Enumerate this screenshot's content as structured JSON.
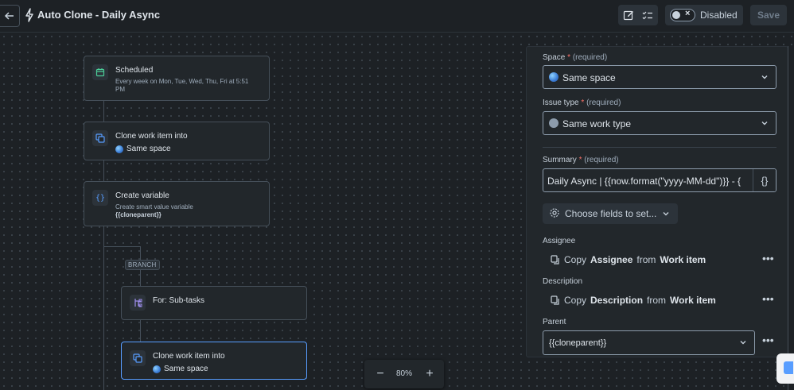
{
  "header": {
    "back_icon": "arrow-left-icon",
    "rule_icon": "lightning-bolt-icon",
    "title": "Auto Clone - Daily Async",
    "toggle_label": "Disabled",
    "save_label": "Save"
  },
  "canvas": {
    "nodes": {
      "scheduled": {
        "title": "Scheduled",
        "sub": "Every week on Mon, Tue, Wed, Thu, Fri at 5:51 PM"
      },
      "clone1": {
        "title": "Clone work item into",
        "sub": "Same space"
      },
      "variable": {
        "title": "Create variable",
        "sub": "Create smart value variable",
        "var": "{{cloneparent}}"
      },
      "branch_tag": "BRANCH",
      "for_subtasks": {
        "title": "For: Sub-tasks"
      },
      "clone2": {
        "title": "Clone work item into",
        "sub": "Same space"
      }
    },
    "zoom": {
      "value": "80%"
    }
  },
  "panel": {
    "space": {
      "label": "Space",
      "star": "*",
      "hint": "(required)",
      "value": "Same space"
    },
    "issue_type": {
      "label": "Issue type",
      "star": "*",
      "hint": "(required)",
      "value": "Same work type"
    },
    "summary": {
      "label": "Summary",
      "star": "*",
      "hint": "(required)",
      "value": "Daily Async | {{now.format(\"yyyy-MM-dd\")}} - {",
      "brace": "{}"
    },
    "choose_fields": "Choose fields to set...",
    "assignee": {
      "label": "Assignee",
      "copy": "Copy",
      "field": "Assignee",
      "from": "from",
      "source": "Work item"
    },
    "description": {
      "label": "Description",
      "copy": "Copy",
      "field": "Description",
      "from": "from",
      "source": "Work item"
    },
    "parent": {
      "label": "Parent",
      "value": "{{cloneparent}}"
    },
    "more_glyph": "•••"
  },
  "colors": {
    "accent": "#579dff",
    "required": "#f87168",
    "background": "#1d2125"
  }
}
